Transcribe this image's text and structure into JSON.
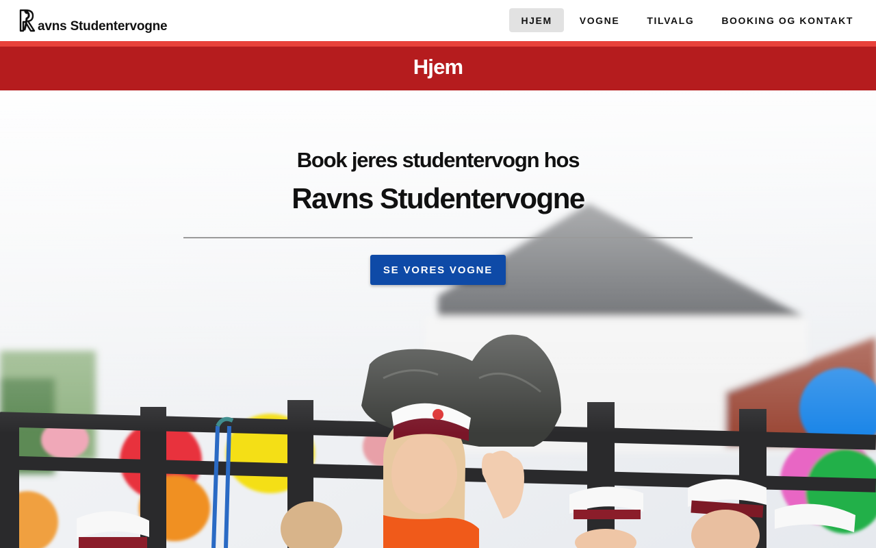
{
  "brand": {
    "name": "avns Studentervogne",
    "logo_icon": "raven-r-logo"
  },
  "nav": {
    "items": [
      {
        "label": "HJEM",
        "active": true
      },
      {
        "label": "VOGNE",
        "active": false
      },
      {
        "label": "TILVALG",
        "active": false
      },
      {
        "label": "BOOKING OG KONTAKT",
        "active": false
      }
    ]
  },
  "page": {
    "title": "Hjem"
  },
  "hero": {
    "subtitle": "Book jeres studentervogn hos",
    "title": "Ravns Studentervogne",
    "cta_label": "SE VORES VOGNE"
  },
  "colors": {
    "accent_stripe": "#e8413a",
    "title_bar": "#b51c1e",
    "cta": "#0e4aa7",
    "nav_active_bg": "#e2e2e2"
  }
}
